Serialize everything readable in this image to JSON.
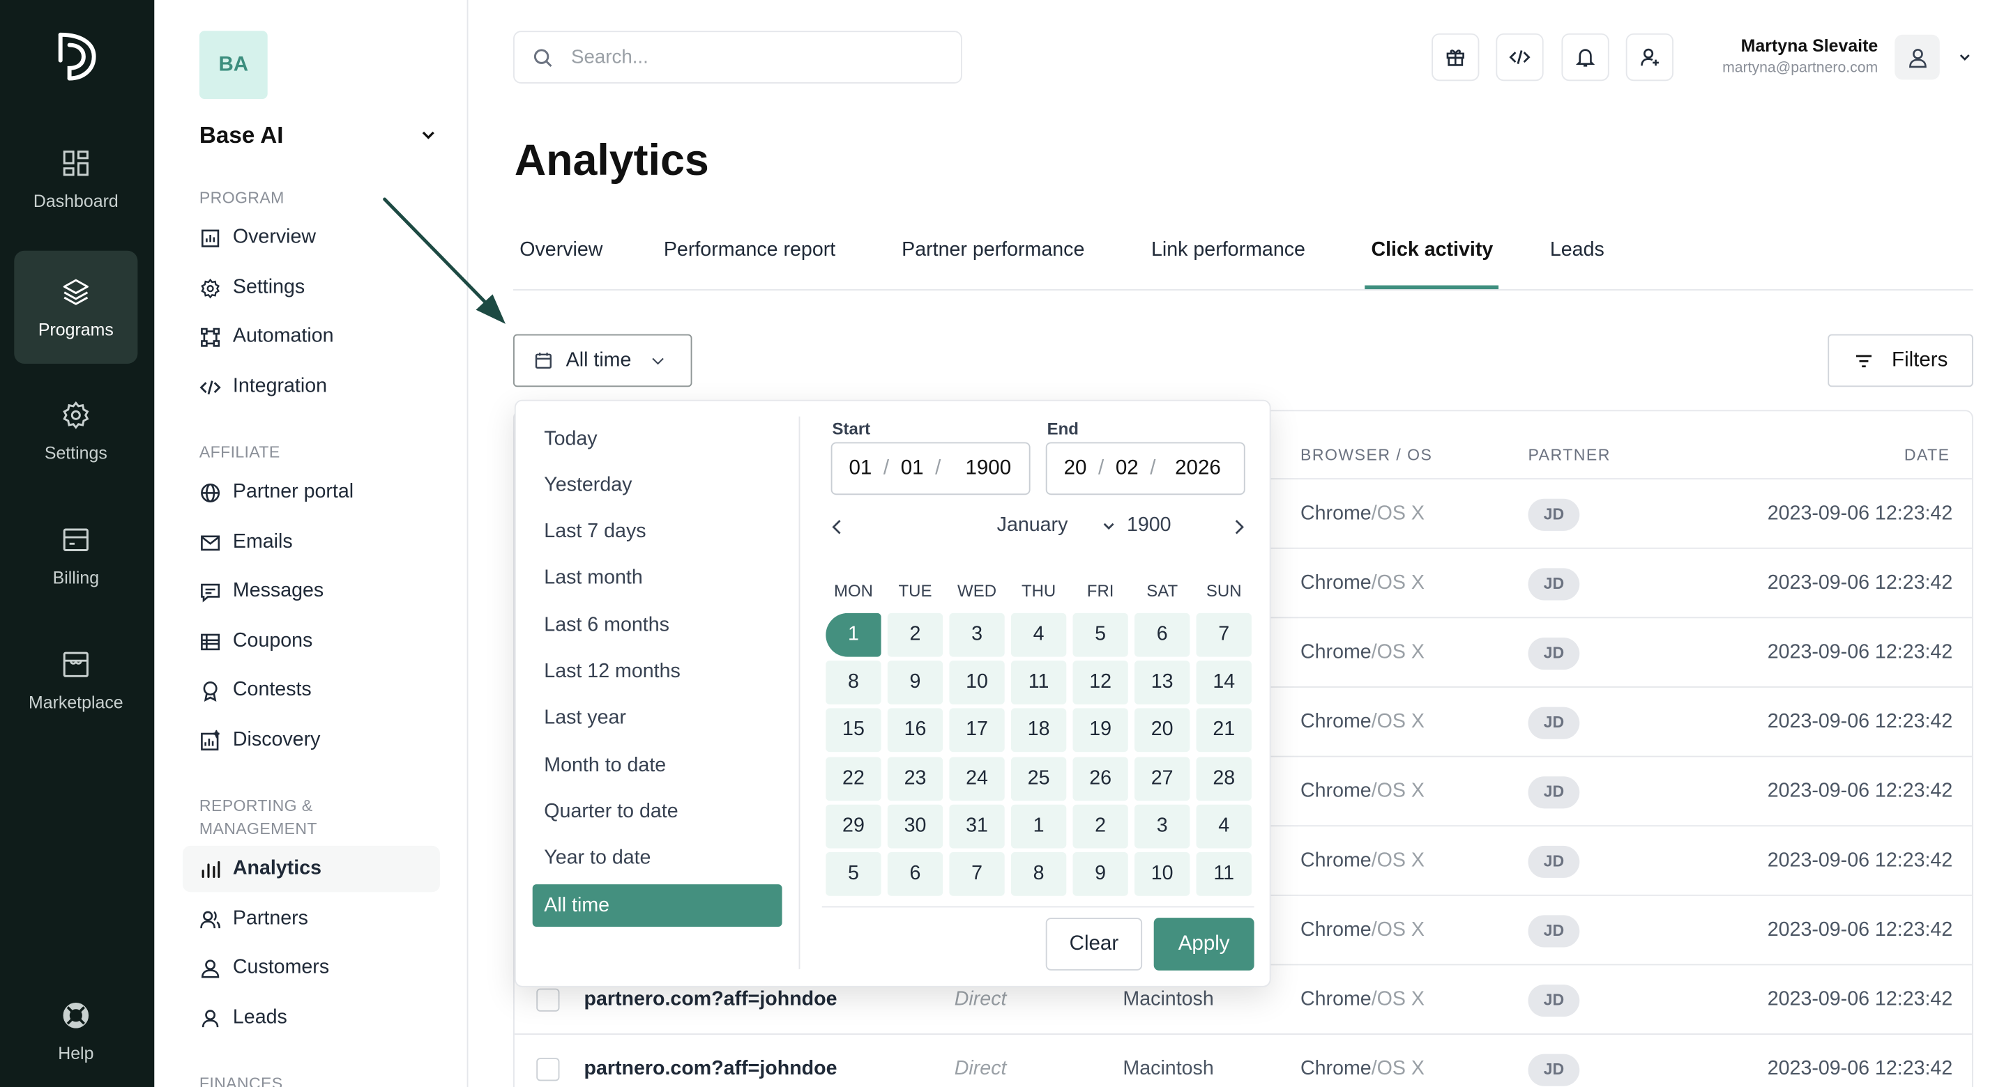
{
  "rail": {
    "items": [
      {
        "label": "Dashboard",
        "icon": "dashboard-icon"
      },
      {
        "label": "Programs",
        "icon": "layers-icon"
      },
      {
        "label": "Settings",
        "icon": "gear-icon"
      },
      {
        "label": "Billing",
        "icon": "billing-icon"
      },
      {
        "label": "Marketplace",
        "icon": "store-icon"
      }
    ],
    "help": "Help"
  },
  "sidebar": {
    "program_initials": "BA",
    "program_name": "Base AI",
    "sections": {
      "program": "PROGRAM",
      "affiliate": "AFFILIATE",
      "reporting": "REPORTING & MANAGEMENT",
      "finances": "FINANCES"
    },
    "items": [
      {
        "label": "Overview",
        "icon": "chart-bar-icon"
      },
      {
        "label": "Settings",
        "icon": "gear-icon"
      },
      {
        "label": "Automation",
        "icon": "automation-icon"
      },
      {
        "label": "Integration",
        "icon": "code-icon"
      },
      {
        "label": "Partner portal",
        "icon": "globe-icon"
      },
      {
        "label": "Emails",
        "icon": "mail-icon"
      },
      {
        "label": "Messages",
        "icon": "message-icon"
      },
      {
        "label": "Coupons",
        "icon": "coupon-icon"
      },
      {
        "label": "Contests",
        "icon": "award-icon"
      },
      {
        "label": "Discovery",
        "icon": "discovery-icon"
      },
      {
        "label": "Analytics",
        "icon": "analytics-icon",
        "active": true
      },
      {
        "label": "Partners",
        "icon": "partners-icon"
      },
      {
        "label": "Customers",
        "icon": "customers-icon"
      },
      {
        "label": "Leads",
        "icon": "leads-icon"
      }
    ]
  },
  "header": {
    "search_placeholder": "Search...",
    "user_name": "Martyna Slevaite",
    "user_email": "martyna@partnero.com"
  },
  "page": {
    "title": "Analytics",
    "tabs": [
      "Overview",
      "Performance report",
      "Partner performance",
      "Link performance",
      "Click activity",
      "Leads"
    ],
    "active_tab": "Click activity",
    "date_button": "All time",
    "filters_button": "Filters"
  },
  "table": {
    "headers": {
      "browser": "BROWSER / OS",
      "partner": "PARTNER",
      "date": "DATE"
    },
    "rows": [
      {
        "link": "",
        "source": "",
        "device": "",
        "browser": "Chrome",
        "os": "OS X",
        "partner": "JD",
        "date": "2023-09-06 12:23:42"
      },
      {
        "link": "",
        "source": "",
        "device": "",
        "browser": "Chrome",
        "os": "OS X",
        "partner": "JD",
        "date": "2023-09-06 12:23:42"
      },
      {
        "link": "",
        "source": "",
        "device": "",
        "browser": "Chrome",
        "os": "OS X",
        "partner": "JD",
        "date": "2023-09-06 12:23:42"
      },
      {
        "link": "",
        "source": "",
        "device": "",
        "browser": "Chrome",
        "os": "OS X",
        "partner": "JD",
        "date": "2023-09-06 12:23:42"
      },
      {
        "link": "",
        "source": "",
        "device": "",
        "browser": "Chrome",
        "os": "OS X",
        "partner": "JD",
        "date": "2023-09-06 12:23:42"
      },
      {
        "link": "",
        "source": "",
        "device": "",
        "browser": "Chrome",
        "os": "OS X",
        "partner": "JD",
        "date": "2023-09-06 12:23:42"
      },
      {
        "link": "",
        "source": "",
        "device": "",
        "browser": "Chrome",
        "os": "OS X",
        "partner": "JD",
        "date": "2023-09-06 12:23:42"
      },
      {
        "link": "partnero.com?aff=johndoe",
        "source": "Direct",
        "device": "Macintosh",
        "browser": "Chrome",
        "os": "OS X",
        "partner": "JD",
        "date": "2023-09-06 12:23:42"
      },
      {
        "link": "partnero.com?aff=johndoe",
        "source": "Direct",
        "device": "Macintosh",
        "browser": "Chrome",
        "os": "OS X",
        "partner": "JD",
        "date": "2023-09-06 12:23:42"
      }
    ]
  },
  "datepicker": {
    "presets": [
      "Today",
      "Yesterday",
      "Last 7 days",
      "Last month",
      "Last 6 months",
      "Last 12 months",
      "Last year",
      "Month to date",
      "Quarter to date",
      "Year to date",
      "All time"
    ],
    "active_preset": "All time",
    "start_label": "Start",
    "end_label": "End",
    "start": {
      "d": "01",
      "m": "01",
      "y": "1900"
    },
    "end": {
      "d": "20",
      "m": "02",
      "y": "2026"
    },
    "date_sep": "/",
    "month": "January",
    "year": "1900",
    "weekdays": [
      "MON",
      "TUE",
      "WED",
      "THU",
      "FRI",
      "SAT",
      "SUN"
    ],
    "days": [
      "1",
      "2",
      "3",
      "4",
      "5",
      "6",
      "7",
      "8",
      "9",
      "10",
      "11",
      "12",
      "13",
      "14",
      "15",
      "16",
      "17",
      "18",
      "19",
      "20",
      "21",
      "22",
      "23",
      "24",
      "25",
      "26",
      "27",
      "28",
      "29",
      "30",
      "31",
      "1",
      "2",
      "3",
      "4",
      "5",
      "6",
      "7",
      "8",
      "9",
      "10",
      "11"
    ],
    "selected_day": "1",
    "clear": "Clear",
    "apply": "Apply"
  },
  "colors": {
    "accent": "#44907f",
    "rail_bg": "#0f1c1a",
    "day_bg": "#ecf6f3",
    "arrow": "#1d4a43"
  }
}
